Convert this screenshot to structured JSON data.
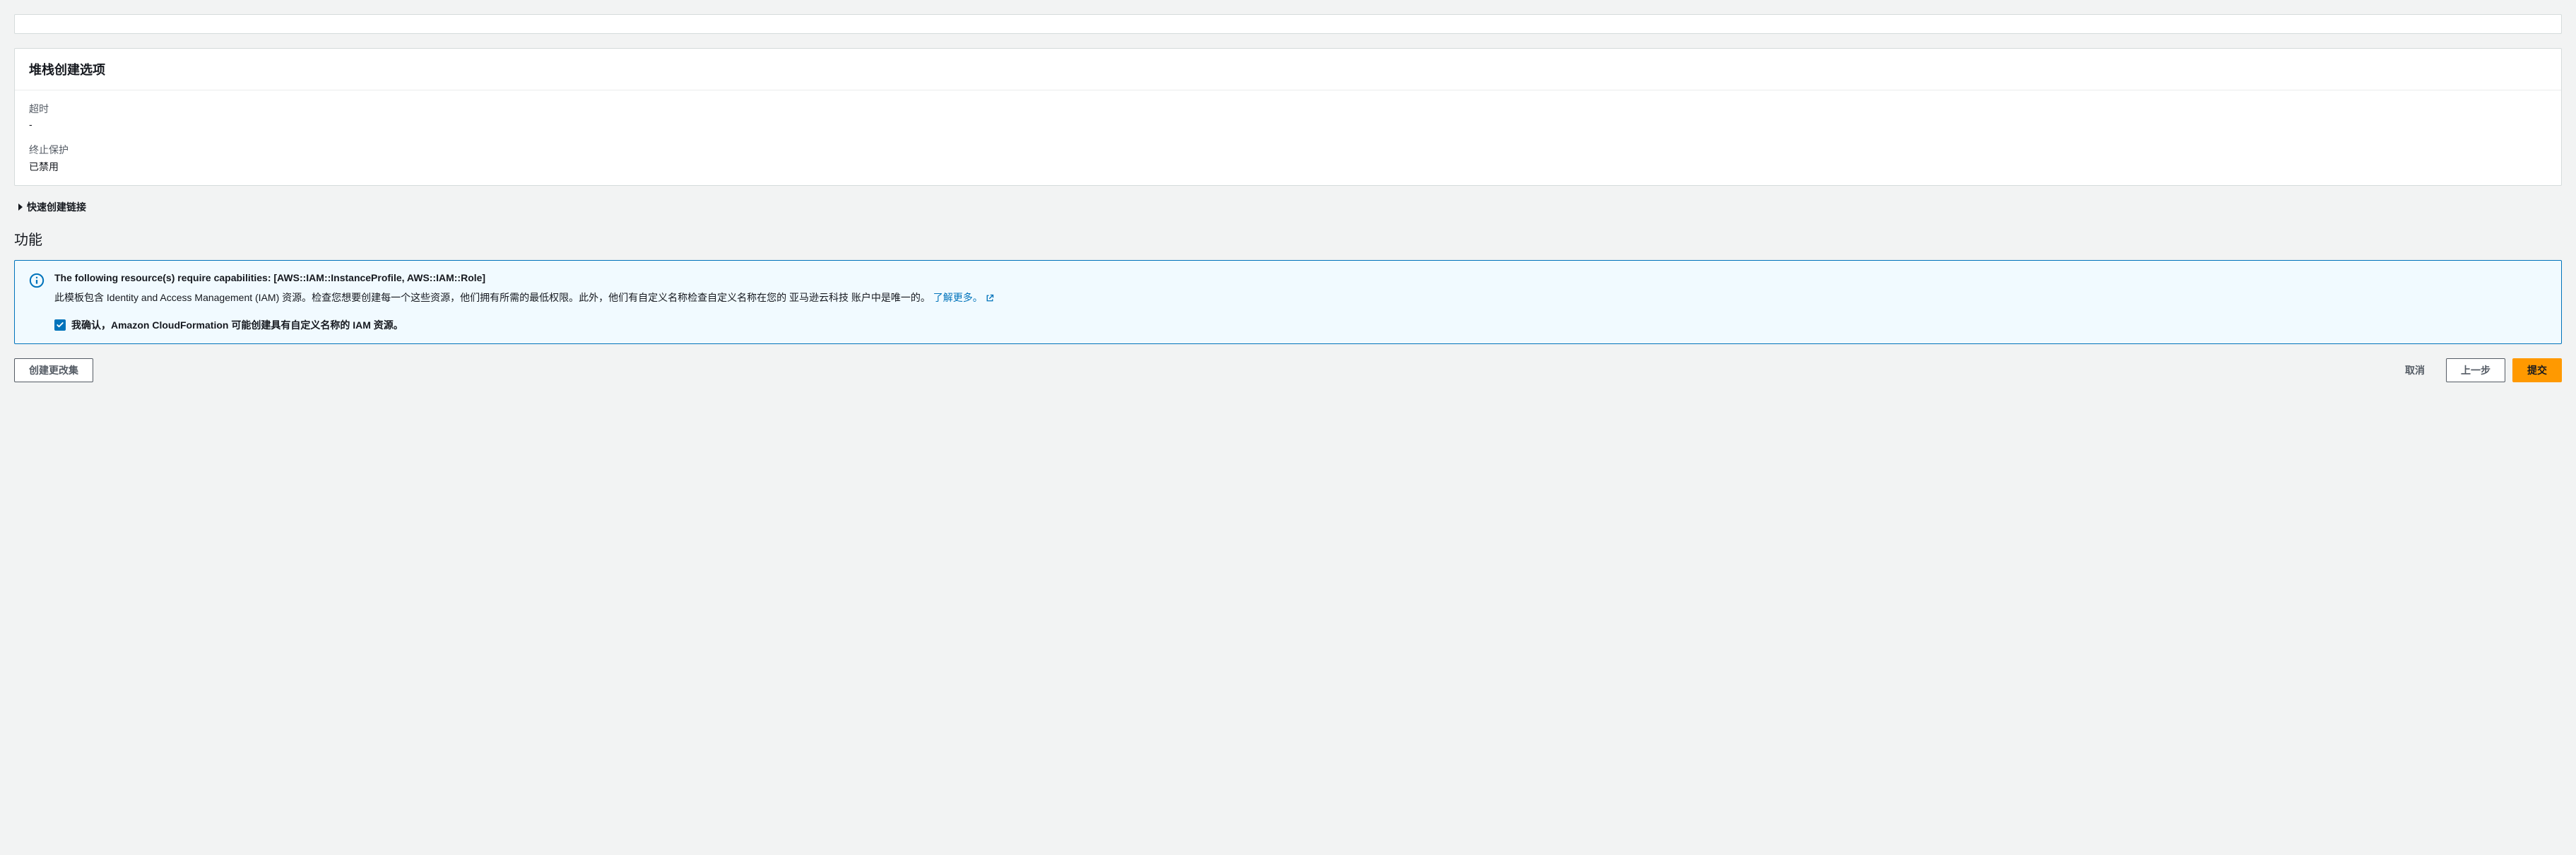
{
  "stackOptions": {
    "title": "堆栈创建选项",
    "timeout": {
      "label": "超时",
      "value": "-"
    },
    "terminationProtection": {
      "label": "终止保护",
      "value": "已禁用"
    }
  },
  "quickCreate": {
    "label": "快速创建链接"
  },
  "capabilities": {
    "title": "功能",
    "alert": {
      "title": "The following resource(s) require capabilities: [AWS::IAM::InstanceProfile, AWS::IAM::Role]",
      "description": "此模板包含 Identity and Access Management (IAM) 资源。检查您想要创建每一个这些资源，他们拥有所需的最低权限。此外，他们有自定义名称检查自定义名称在您的 亚马逊云科技 账户中是唯一的。",
      "learnMore": "了解更多。",
      "acknowledge": "我确认，Amazon CloudFormation 可能创建具有自定义名称的 IAM 资源。"
    }
  },
  "footer": {
    "createChangeSet": "创建更改集",
    "cancel": "取消",
    "previous": "上一步",
    "submit": "提交"
  }
}
